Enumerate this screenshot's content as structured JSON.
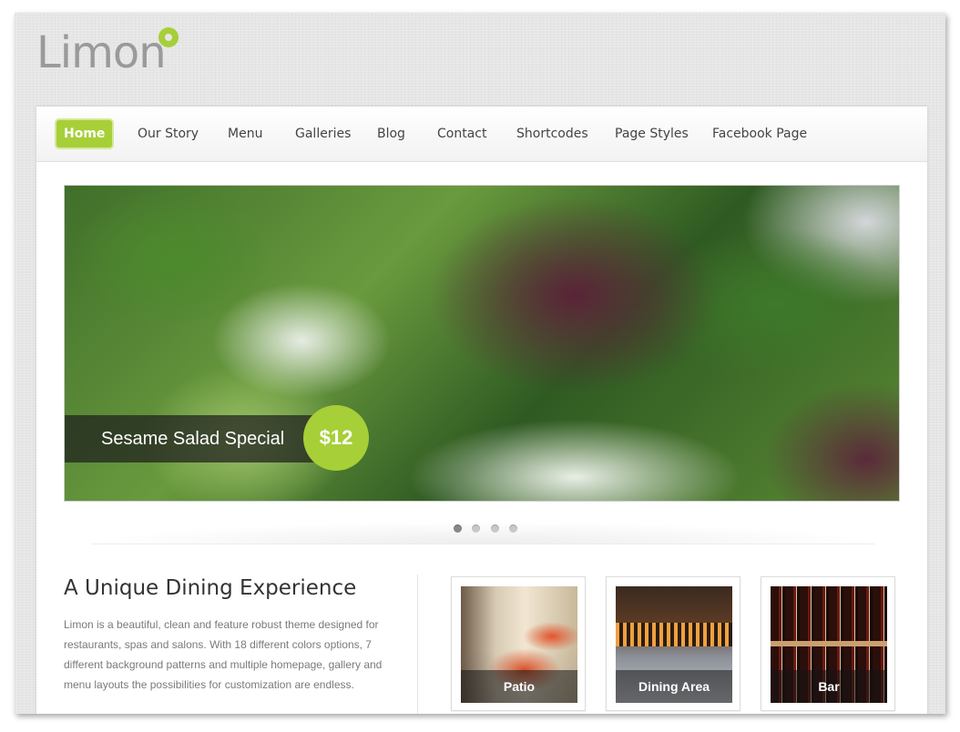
{
  "site": {
    "logo_text": "Limon",
    "brand_color": "#a6cf38"
  },
  "nav": {
    "items": [
      {
        "label": "Home",
        "active": true
      },
      {
        "label": "Our Story"
      },
      {
        "label": "Menu"
      },
      {
        "label": "Galleries"
      },
      {
        "label": "Blog"
      },
      {
        "label": "Contact"
      },
      {
        "label": "Shortcodes"
      },
      {
        "label": "Page Styles"
      },
      {
        "label": "Facebook Page"
      }
    ]
  },
  "slider": {
    "caption": "Sesame Salad Special",
    "price": "$12",
    "slide_count": 4,
    "active_slide": 1
  },
  "intro": {
    "heading": "A Unique Dining Experience",
    "body": "Limon is a beautiful, clean and feature robust theme designed for restaurants, spas and salons. With 18 different colors options, 7 different background patterns and multiple homepage, gallery and menu layouts the possibilities for customization are endless."
  },
  "gallery": [
    {
      "label": "Patio"
    },
    {
      "label": "Dining Area"
    },
    {
      "label": "Bar"
    }
  ]
}
